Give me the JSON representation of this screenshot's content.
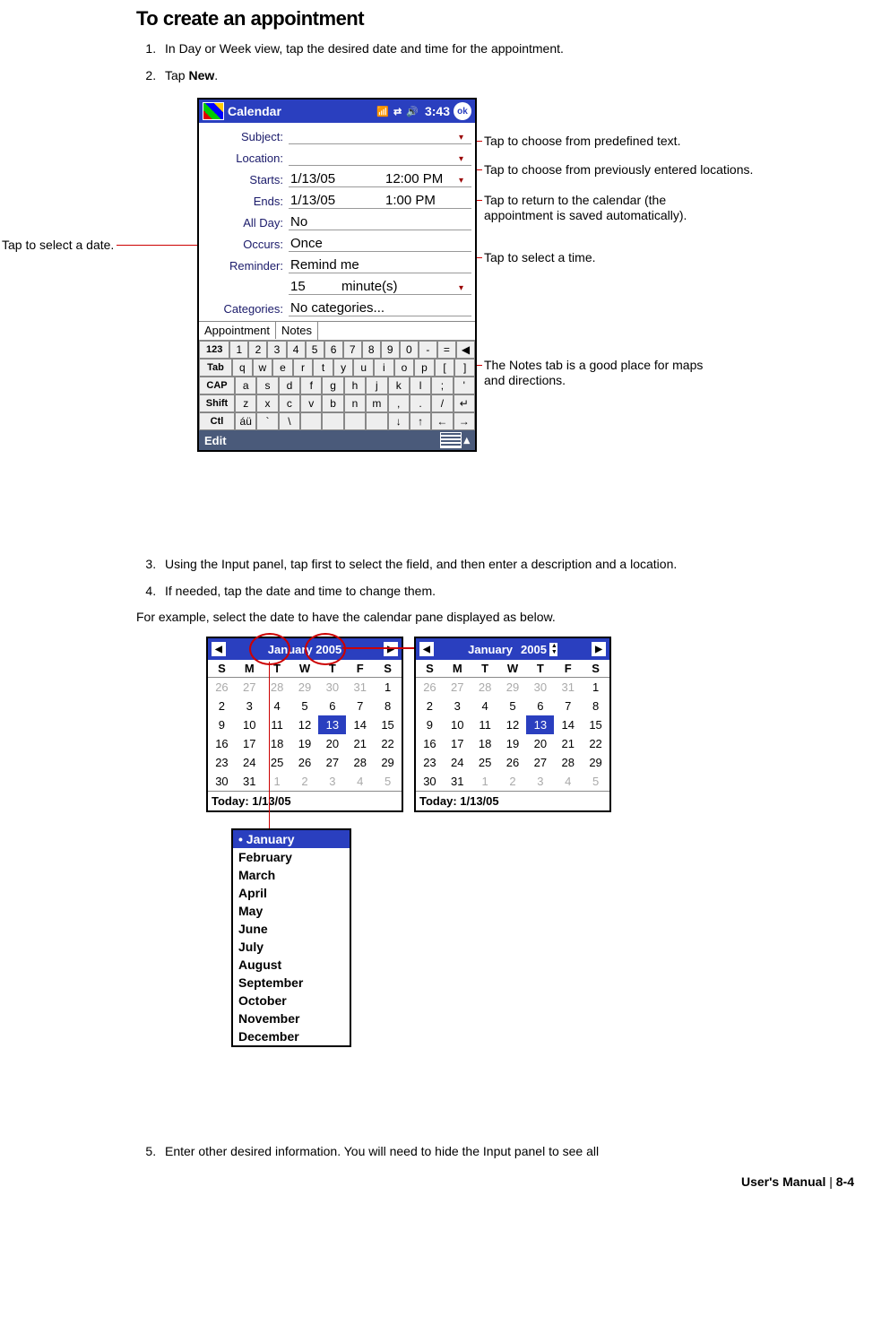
{
  "title": "To create an appointment",
  "steps": {
    "s1": "In Day or Week view, tap the desired date and time for the appointment.",
    "s2_pre": "Tap ",
    "s2_bold": "New",
    "s2_post": ".",
    "s3": "Using the Input panel, tap first to select the field, and then enter a description and a location.",
    "s4": "If needed, tap the date and time to change them.",
    "s4_after": "For example, select the date to have the calendar pane displayed as below.",
    "s5": "Enter other desired information. You will need to hide the Input panel to see all"
  },
  "callouts": {
    "left_date": "Tap to select a date.",
    "c_predef": "Tap to choose from predefined text.",
    "c_loc": "Tap to choose from previously entered locations.",
    "c_return1": "Tap to return to the calendar (the",
    "c_return2": "appointment is saved automatically).",
    "c_time": "Tap to select a time.",
    "c_notes1": "The Notes tab is a good place for maps",
    "c_notes2": "and directions."
  },
  "pda": {
    "app": "Calendar",
    "time": "3:43",
    "icons": "📶 ⇄ 🔊",
    "ok": "ok",
    "labels": {
      "subject": "Subject:",
      "location": "Location:",
      "starts": "Starts:",
      "ends": "Ends:",
      "allday": "All Day:",
      "occurs": "Occurs:",
      "reminder": "Reminder:",
      "categories": "Categories:"
    },
    "values": {
      "starts_date": "1/13/05",
      "starts_time": "12:00 PM",
      "ends_date": "1/13/05",
      "ends_time": "1:00 PM",
      "allday": "No",
      "occurs": "Once",
      "reminder": "Remind me",
      "reminder2a": "15",
      "reminder2b": "minute(s)",
      "categories": "No categories..."
    },
    "tabs": {
      "appt": "Appointment",
      "notes": "Notes"
    },
    "bottom": "Edit",
    "kb": {
      "r1": [
        "123",
        "1",
        "2",
        "3",
        "4",
        "5",
        "6",
        "7",
        "8",
        "9",
        "0",
        "-",
        "=",
        "◀"
      ],
      "r2": [
        "Tab",
        "q",
        "w",
        "e",
        "r",
        "t",
        "y",
        "u",
        "i",
        "o",
        "p",
        "[",
        "]"
      ],
      "r3": [
        "CAP",
        "a",
        "s",
        "d",
        "f",
        "g",
        "h",
        "j",
        "k",
        "l",
        ";",
        "'"
      ],
      "r4": [
        "Shift",
        "z",
        "x",
        "c",
        "v",
        "b",
        "n",
        "m",
        ",",
        ".",
        "/",
        "↵"
      ],
      "r5": [
        "Ctl",
        "áü",
        "`",
        "\\",
        " ",
        " ",
        " ",
        " ",
        "↓",
        "↑",
        "←",
        "→"
      ]
    }
  },
  "cal": {
    "month_year": "January 2005",
    "month_label": "January",
    "year": "2005",
    "dayhead": [
      "S",
      "M",
      "T",
      "W",
      "T",
      "F",
      "S"
    ],
    "grid": [
      {
        "v": "26",
        "d": 1
      },
      {
        "v": "27",
        "d": 1
      },
      {
        "v": "28",
        "d": 1
      },
      {
        "v": "29",
        "d": 1
      },
      {
        "v": "30",
        "d": 1
      },
      {
        "v": "31",
        "d": 1
      },
      {
        "v": "1"
      },
      {
        "v": "2"
      },
      {
        "v": "3"
      },
      {
        "v": "4"
      },
      {
        "v": "5"
      },
      {
        "v": "6"
      },
      {
        "v": "7"
      },
      {
        "v": "8"
      },
      {
        "v": "9"
      },
      {
        "v": "10"
      },
      {
        "v": "11"
      },
      {
        "v": "12"
      },
      {
        "v": "13",
        "s": 1
      },
      {
        "v": "14"
      },
      {
        "v": "15"
      },
      {
        "v": "16"
      },
      {
        "v": "17"
      },
      {
        "v": "18"
      },
      {
        "v": "19"
      },
      {
        "v": "20"
      },
      {
        "v": "21"
      },
      {
        "v": "22"
      },
      {
        "v": "23"
      },
      {
        "v": "24"
      },
      {
        "v": "25"
      },
      {
        "v": "26"
      },
      {
        "v": "27"
      },
      {
        "v": "28"
      },
      {
        "v": "29"
      },
      {
        "v": "30"
      },
      {
        "v": "31"
      },
      {
        "v": "1",
        "d": 1
      },
      {
        "v": "2",
        "d": 1
      },
      {
        "v": "3",
        "d": 1
      },
      {
        "v": "4",
        "d": 1
      },
      {
        "v": "5",
        "d": 1
      }
    ],
    "today": "Today: 1/13/05",
    "months": [
      "January",
      "February",
      "March",
      "April",
      "May",
      "June",
      "July",
      "August",
      "September",
      "October",
      "November",
      "December"
    ]
  },
  "footer": {
    "t1": "User's Manual",
    "sep": " | ",
    "t2": "8-4"
  }
}
